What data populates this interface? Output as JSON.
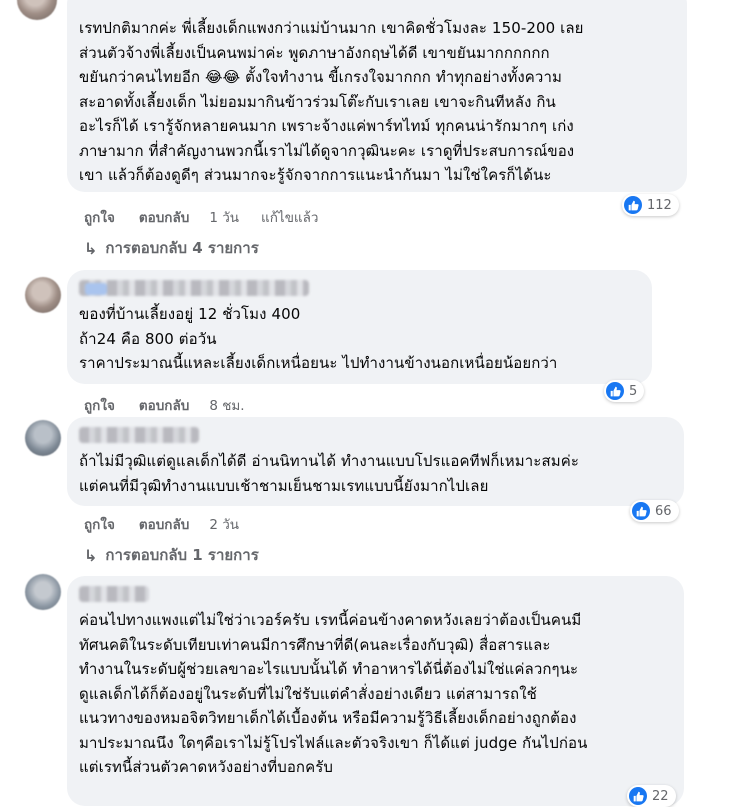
{
  "comments": [
    {
      "text": "เรทปกติมากค่ะ พี่เลี้ยงเด็กแพงกว่าแม่บ้านมาก เขาคิดชั่วโมงละ 150-200 เลย\nส่วนตัวจ้างพี่เลี้ยงเป็นคนพม่าค่ะ พูดภาษาอังกฤษได้ดี เขาขยันมากกกกกก\nขยันกว่าคนไทยอีก 😂😂 ตั้งใจทำงาน ขี้เกรงใจมากกก ทำทุกอย่างทั้งความ\nสะอาดทั้งเลี้ยงเด็ก ไม่ยอมมากินข้าวร่วมโต๊ะกับเราเลย เขาจะกินทีหลัง กิน\nอะไรก็ได้ เรารู้จักหลายคนมาก เพราะจ้างแค่พาร์ทไทม์ ทุกคนน่ารักมากๆ เก่ง\nภาษามาก ที่สำคัญงานพวกนี้เราไม่ได้ดูจากวุฒินะคะ เราดูที่ประสบการณ์ของ\nเขา แล้วก็ต้องดูดีๆ ส่วนมากจะรู้จักจากการแนะนำกันมา ไม่ใช่ใครก็ได้นะ",
      "like": "ถูกใจ",
      "reply": "ตอบกลับ",
      "time": "1 วัน",
      "edited": "แก้ไขแล้ว",
      "reactions": "112",
      "replies": "การตอบกลับ 4 รายการ"
    },
    {
      "text": "ของที่บ้านเลี้ยงอยู่ 12 ชั่วโมง 400\nถ้า24 คือ 800 ต่อวัน\nราคาประมาณนี้แหละเลี้ยงเด็กเหนื่อยนะ ไปทำงานข้างนอกเหนื่อยน้อยกว่า",
      "like": "ถูกใจ",
      "reply": "ตอบกลับ",
      "time": "8 ชม.",
      "reactions": "5"
    },
    {
      "text": "ถ้าไม่มีวุฒิแต่ดูแลเด็กได้ดี อ่านนิทานได้ ทำงานแบบโปรแอคทีฟก็เหมาะสมค่ะ\nแต่คนที่มีวุฒิทำงานแบบเช้าชามเย็นชามเรทแบบนี้ยังมากไปเลย",
      "like": "ถูกใจ",
      "reply": "ตอบกลับ",
      "time": "2 วัน",
      "reactions": "66",
      "replies": "การตอบกลับ 1 รายการ"
    },
    {
      "text": "ค่อนไปทางแพงแต่ไม่ใช่ว่าเวอร์ครับ เรทนี้ค่อนข้างคาดหวังเลยว่าต้องเป็นคนมี\nทัศนคติในระดับเทียบเท่าคนมีการศึกษาที่ดี(คนละเรื่องกับวุฒิ) สื่อสารและ\nทำงานในระดับผู้ช่วยเลขาอะไรแบบนั้นได้ ทำอาหารได้นี่ต้องไม่ใช่แค่ลวกๆนะ\nดูแลเด็กได้ก็ต้องอยู่ในระดับที่ไม่ใช่รับแต่คำสั่งอย่างเดียว แต่สามารถใช้\nแนวทางของหมอจิตวิทยาเด็กได้เบื้องต้น หรือมีความรู้วิธีเลี้ยงเด็กอย่างถูกต้อง\nมาประมาณนึง ใดๆคือเราไม่รู้โปรไฟล์และตัวจริงเขา ก็ได้แต่ judge กันไปก่อน\nแต่เรทนี้ส่วนตัวคาดหวังอย่างที่บอกครับ",
      "reactions": "22"
    }
  ],
  "colors": {
    "like_blue": "#1877f2",
    "bubble_bg": "#f0f2f5",
    "meta_gray": "#65676b"
  },
  "icons": {
    "like": "thumbs-up-icon",
    "reply_arrow": "reply-arrow-icon"
  }
}
